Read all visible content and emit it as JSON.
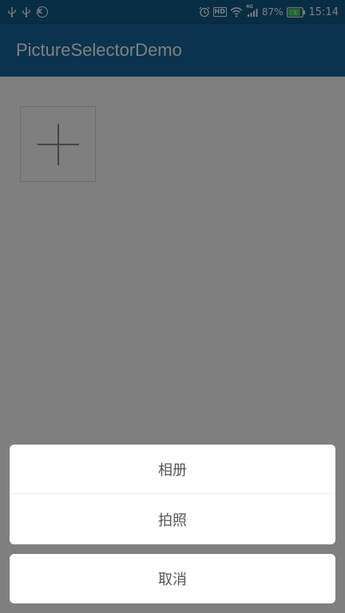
{
  "status_bar": {
    "left_icons": [
      "usb-icon",
      "usb-icon",
      "k-circle-icon"
    ],
    "k_letter": "K",
    "hd_label": "HD",
    "network_label": "4G",
    "battery_percent": "87%",
    "time": "15:14",
    "battery_level": 0.87,
    "colors": {
      "background": "#0e5a88",
      "battery_fill": "#4cd964"
    }
  },
  "toolbar": {
    "title": "PictureSelectorDemo",
    "color": "#12679c"
  },
  "content": {
    "add_button_icon": "plus-icon"
  },
  "action_sheet": {
    "album_label": "相册",
    "camera_label": "拍照",
    "cancel_label": "取消"
  }
}
